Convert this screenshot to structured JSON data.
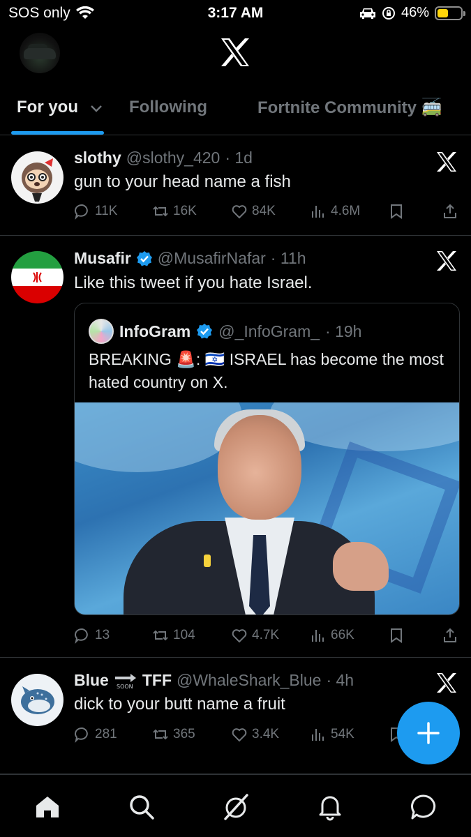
{
  "status_bar": {
    "carrier": "SOS only",
    "time": "3:17 AM",
    "battery": "46%",
    "battery_fraction": 0.46
  },
  "header": {
    "logo": "x-logo-icon"
  },
  "tabs": [
    {
      "label": "For you",
      "active": true
    },
    {
      "label": "Following",
      "active": false
    },
    {
      "label": "Fortnite Community 🚎",
      "active": false
    }
  ],
  "posts": [
    {
      "name": "slothy",
      "handle": "@slothy_420",
      "time": "· 1d",
      "text": "gun to your head name a fish",
      "replies": "11K",
      "reposts": "16K",
      "likes": "84K",
      "views": "4.6M"
    },
    {
      "name": "Musafir",
      "handle": "@MusafirNafar",
      "time": "· 11h",
      "text": "Like this tweet if you hate Israel.",
      "quote": {
        "name": "InfoGram",
        "handle": "@_InfoGram_",
        "time": "· 19h",
        "text": "BREAKING 🚨: 🇮🇱 ISRAEL has become the most hated country on X."
      },
      "replies": "13",
      "reposts": "104",
      "likes": "4.7K",
      "views": "66K"
    },
    {
      "name": "Blue",
      "name_suffix": "TFF",
      "handle": "@WhaleShark_Blue",
      "time": "· 4h",
      "text": "dick to your butt name a fruit",
      "replies": "281",
      "reposts": "365",
      "likes": "3.4K",
      "views": "54K"
    }
  ],
  "colors": {
    "accent": "#1d9bf0",
    "background": "#000000",
    "muted": "#71767b",
    "text": "#e7e9ea"
  }
}
